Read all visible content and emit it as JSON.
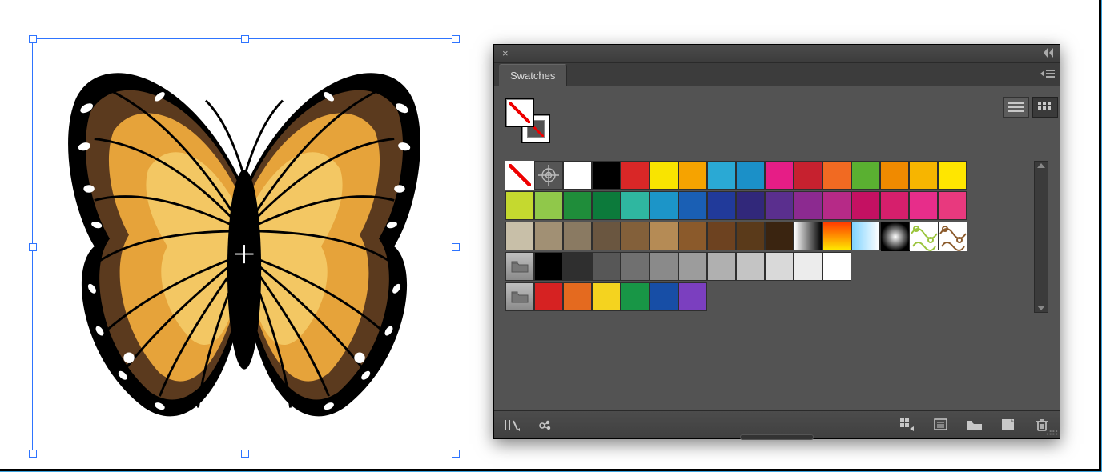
{
  "panel": {
    "title": "Swatches",
    "view_mode": "grid",
    "fill": "none",
    "stroke": "none"
  },
  "footer_icons": [
    "library-icon",
    "color-group-icon",
    "swatch-options-icon",
    "new-swatch-list-icon",
    "new-folder-icon",
    "new-swatch-icon",
    "trash-icon"
  ],
  "rows": [
    {
      "group": false,
      "cells": [
        {
          "kind": "none",
          "selected": true
        },
        {
          "kind": "registration"
        },
        {
          "kind": "solid",
          "c": "#ffffff"
        },
        {
          "kind": "solid",
          "c": "#000000"
        },
        {
          "kind": "solid",
          "c": "#d92727"
        },
        {
          "kind": "solid",
          "c": "#f9e400"
        },
        {
          "kind": "solid",
          "c": "#f6a300"
        },
        {
          "kind": "solid",
          "c": "#2aa9d4"
        },
        {
          "kind": "solid",
          "c": "#1b90c8"
        },
        {
          "kind": "solid",
          "c": "#e61d86"
        },
        {
          "kind": "solid",
          "c": "#c6212f"
        },
        {
          "kind": "solid",
          "c": "#f16a22"
        },
        {
          "kind": "solid",
          "c": "#5ab031"
        },
        {
          "kind": "solid",
          "c": "#f08a00"
        },
        {
          "kind": "solid",
          "c": "#f7b500"
        },
        {
          "kind": "solid",
          "c": "#ffe600"
        }
      ]
    },
    {
      "group": false,
      "cells": [
        {
          "kind": "solid",
          "c": "#c5d92f"
        },
        {
          "kind": "solid",
          "c": "#90c84a"
        },
        {
          "kind": "solid",
          "c": "#1f8d3a"
        },
        {
          "kind": "solid",
          "c": "#0c7a3b"
        },
        {
          "kind": "solid",
          "c": "#2fb7a0"
        },
        {
          "kind": "solid",
          "c": "#1c95c8"
        },
        {
          "kind": "solid",
          "c": "#1a5fb4"
        },
        {
          "kind": "solid",
          "c": "#213a9a"
        },
        {
          "kind": "solid",
          "c": "#31287a"
        },
        {
          "kind": "solid",
          "c": "#5a2f8e"
        },
        {
          "kind": "solid",
          "c": "#8c2a90"
        },
        {
          "kind": "solid",
          "c": "#b62a87"
        },
        {
          "kind": "solid",
          "c": "#c41162"
        },
        {
          "kind": "solid",
          "c": "#d61f6c"
        },
        {
          "kind": "solid",
          "c": "#e72d8a"
        },
        {
          "kind": "solid",
          "c": "#e8397e"
        }
      ]
    },
    {
      "group": false,
      "cells": [
        {
          "kind": "solid",
          "c": "#c8bfa8"
        },
        {
          "kind": "solid",
          "c": "#a19074"
        },
        {
          "kind": "solid",
          "c": "#8a7a62"
        },
        {
          "kind": "solid",
          "c": "#6a5640"
        },
        {
          "kind": "solid",
          "c": "#83603a"
        },
        {
          "kind": "solid",
          "c": "#b58b55"
        },
        {
          "kind": "solid",
          "c": "#8b5a2b"
        },
        {
          "kind": "solid",
          "c": "#6d4220"
        },
        {
          "kind": "solid",
          "c": "#5a3a1a"
        },
        {
          "kind": "solid",
          "c": "#3a2410"
        },
        {
          "kind": "grad",
          "stops": [
            "#ffffff",
            "#000000"
          ],
          "dir": "90deg"
        },
        {
          "kind": "grad",
          "stops": [
            "#ff3b00",
            "#ffe600"
          ],
          "dir": "180deg"
        },
        {
          "kind": "grad",
          "stops": [
            "#7fd3ff",
            "#ffffff"
          ],
          "dir": "90deg",
          "checker": true
        },
        {
          "kind": "radial"
        },
        {
          "kind": "pattern",
          "pc": "#9bc53d"
        },
        {
          "kind": "pattern",
          "pc": "#8b5a2b"
        }
      ]
    },
    {
      "group": true,
      "cells": [
        {
          "kind": "solid",
          "c": "#000000"
        },
        {
          "kind": "solid",
          "c": "#2f2f2f"
        },
        {
          "kind": "solid",
          "c": "#575757"
        },
        {
          "kind": "solid",
          "c": "#707070"
        },
        {
          "kind": "solid",
          "c": "#8a8a8a"
        },
        {
          "kind": "solid",
          "c": "#9c9c9c"
        },
        {
          "kind": "solid",
          "c": "#b0b0b0"
        },
        {
          "kind": "solid",
          "c": "#c4c4c4"
        },
        {
          "kind": "solid",
          "c": "#d9d9d9"
        },
        {
          "kind": "solid",
          "c": "#ececec"
        },
        {
          "kind": "solid",
          "c": "#ffffff"
        }
      ]
    },
    {
      "group": true,
      "cells": [
        {
          "kind": "solid",
          "c": "#d62222"
        },
        {
          "kind": "solid",
          "c": "#e46a1f"
        },
        {
          "kind": "solid",
          "c": "#f4d31f"
        },
        {
          "kind": "solid",
          "c": "#189646"
        },
        {
          "kind": "solid",
          "c": "#174ea6"
        },
        {
          "kind": "solid",
          "c": "#7b3fbf"
        }
      ]
    }
  ]
}
